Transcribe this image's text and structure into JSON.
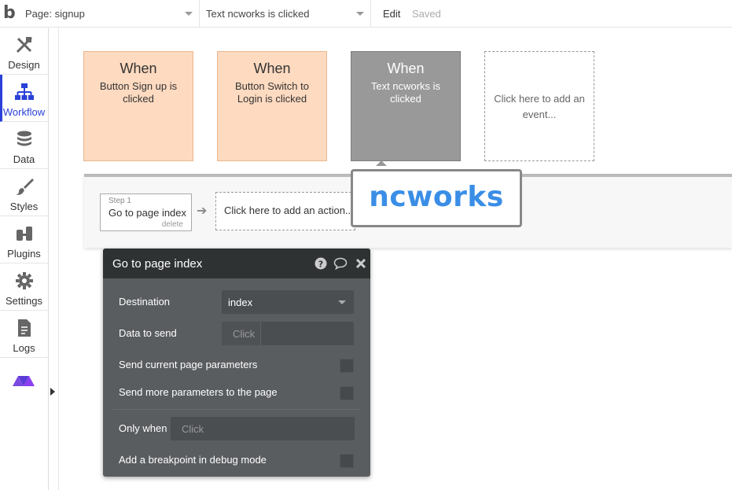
{
  "topbar": {
    "logo": "b",
    "page_select": "Page: signup",
    "event_select": "Text ncworks is clicked",
    "edit_label": "Edit",
    "saved_label": "Saved"
  },
  "sidebar": {
    "items": [
      {
        "label": "Design",
        "icon": "design-icon"
      },
      {
        "label": "Workflow",
        "icon": "workflow-icon"
      },
      {
        "label": "Data",
        "icon": "database-icon"
      },
      {
        "label": "Styles",
        "icon": "brush-icon"
      },
      {
        "label": "Plugins",
        "icon": "plugin-icon"
      },
      {
        "label": "Settings",
        "icon": "gear-icon"
      },
      {
        "label": "Logs",
        "icon": "document-icon"
      },
      {
        "label": "",
        "icon": "bubble-logo-icon"
      }
    ],
    "active": "Workflow"
  },
  "events": [
    {
      "when": "When",
      "desc": "Button Sign up is clicked",
      "style": "peach"
    },
    {
      "when": "When",
      "desc": "Button Switch to Login is clicked",
      "style": "peach"
    },
    {
      "when": "When",
      "desc": "Text ncworks is clicked",
      "style": "gray"
    },
    {
      "when": "",
      "desc": "Click here to add an event...",
      "style": "add"
    }
  ],
  "actions": {
    "step1": {
      "step": "Step 1",
      "title": "Go to page index",
      "delete": "delete"
    },
    "add_action": "Click here to add an action..."
  },
  "callout": {
    "text": "ncworks"
  },
  "panel": {
    "title": "Go to page index",
    "icons": [
      "help-icon",
      "comment-icon",
      "close-icon"
    ],
    "destination_label": "Destination",
    "destination_value": "index",
    "data_to_send_label": "Data to send",
    "data_to_send_placeholder": "Click",
    "send_current_params_label": "Send current page parameters",
    "send_more_params_label": "Send more parameters to the page",
    "only_when_label": "Only when",
    "only_when_placeholder": "Click",
    "breakpoint_label": "Add a breakpoint in debug mode"
  },
  "colors": {
    "accent": "#2a40d8",
    "event_peach": "#fedac0",
    "event_selected": "#999999",
    "panel_bg": "#5a5d60",
    "panel_header": "#2f3233",
    "callout_text": "#3a8ee6"
  }
}
